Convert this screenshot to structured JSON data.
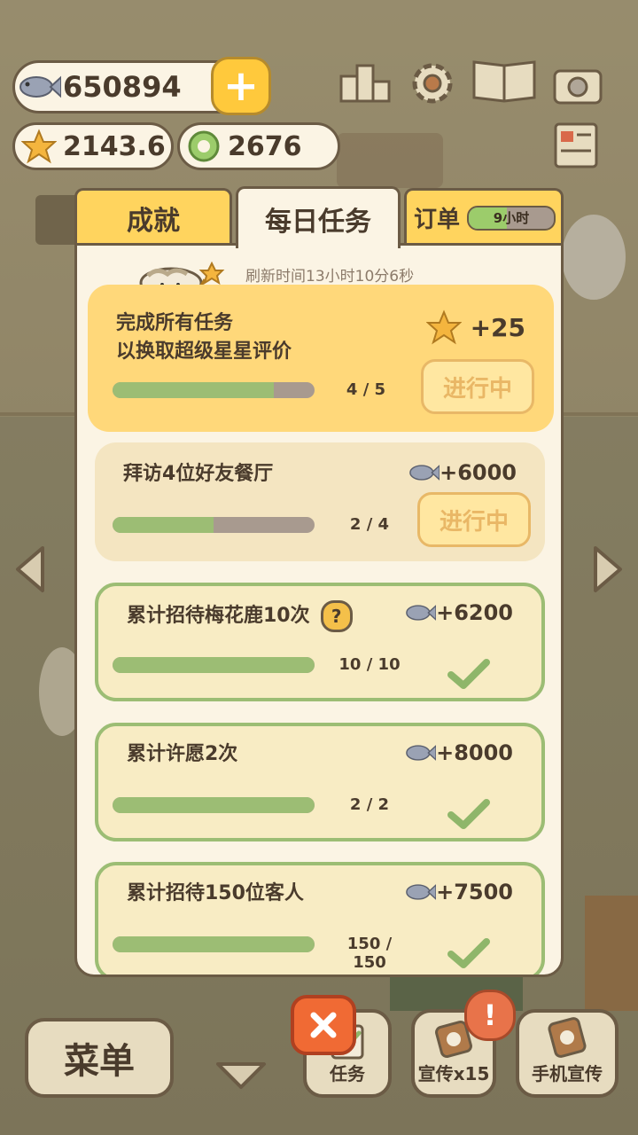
{
  "hud": {
    "fish": "650894",
    "stars": "2143.6",
    "coins": "2676",
    "plus": "+"
  },
  "tabs": {
    "achievements": "成就",
    "daily": "每日任务",
    "orders": "订单",
    "orders_timer": "9小时",
    "orders_timer_fill": 0.45
  },
  "panel": {
    "refresh": "刷新时间13小时10分6秒"
  },
  "tasks": [
    {
      "title_line1": "完成所有任务",
      "title_line2": "以换取超级星星评价",
      "reward": "+25",
      "reward_icon": "star-icon",
      "progress": "4 / 5",
      "fill": 0.8,
      "status": "进行中"
    },
    {
      "title": "拜访4位好友餐厅",
      "reward": "+6000",
      "reward_icon": "fish-icon",
      "progress": "2 / 4",
      "fill": 0.5,
      "status": "进行中"
    },
    {
      "title": "累计招待梅花鹿10次",
      "reward": "+6200",
      "reward_icon": "fish-icon",
      "progress": "10 / 10",
      "fill": 1.0,
      "status": "done",
      "help": "?"
    },
    {
      "title": "累计许愿2次",
      "reward": "+8000",
      "reward_icon": "fish-icon",
      "progress": "2 / 2",
      "fill": 1.0,
      "status": "done"
    },
    {
      "title": "累计招待150位客人",
      "reward": "+7500",
      "reward_icon": "fish-icon",
      "progress": "150 / 150",
      "fill": 1.0,
      "status": "done"
    }
  ],
  "bottom": {
    "menu": "菜单",
    "tasks": "任务",
    "promo": "宣传x15",
    "phone_promo": "手机宣传",
    "alert": "!"
  },
  "colors": {
    "accent": "#ffd45e",
    "panel": "#fbf4e4",
    "done_border": "#9cbd74",
    "close": "#f06a34"
  }
}
